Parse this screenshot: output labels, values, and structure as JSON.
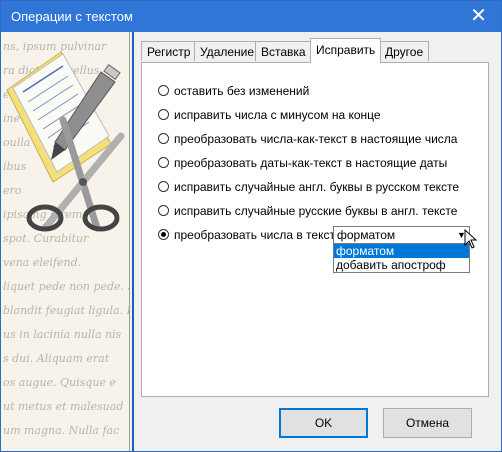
{
  "window": {
    "title": "Операции с текстом",
    "close_glyph": "✕"
  },
  "side_panel": {
    "script_lines": [
      "ns, ipsum pulvinar",
      "ra dict. Phasellus",
      "eu. Morbi",
      "ine",
      "oulla",
      "ibus",
      "ero",
      "ipiscing lorem.",
      "spot. Curabitur",
      "vena eleifend.",
      "liquet pede non pede. Susp",
      "blandit feugiat ligula. D",
      "us in lacinia nulla nis",
      "s dui. Aliquam erat",
      "os augue. Quisque e",
      "ut metus et malesuad",
      "um magna. Nulla fac"
    ]
  },
  "tabs": [
    {
      "label": "Регистр",
      "active": false
    },
    {
      "label": "Удаление",
      "active": false
    },
    {
      "label": "Вставка",
      "active": false
    },
    {
      "label": "Исправить",
      "active": true
    },
    {
      "label": "Другое",
      "active": false
    }
  ],
  "options": [
    {
      "label": "оставить без изменений",
      "checked": false
    },
    {
      "label": "исправить числа с минусом на конце",
      "checked": false
    },
    {
      "label": "преобразовать числа-как-текст в настоящие числа",
      "checked": false
    },
    {
      "label": "преобразовать даты-как-текст в настоящие даты",
      "checked": false
    },
    {
      "label": "исправить случайные англ. буквы в русском тексте",
      "checked": false
    },
    {
      "label": "исправить случайные русские буквы в англ. тексте",
      "checked": false
    },
    {
      "label": "преобразовать числа в текст",
      "checked": true
    }
  ],
  "number_to_text_combo": {
    "value": "форматом",
    "options": [
      "форматом",
      "добавить апостроф"
    ],
    "highlighted": "форматом"
  },
  "buttons": {
    "ok": "OK",
    "cancel": "Отмена"
  },
  "colors": {
    "titlebar": "#2f76d6",
    "accent": "#0078d7"
  }
}
